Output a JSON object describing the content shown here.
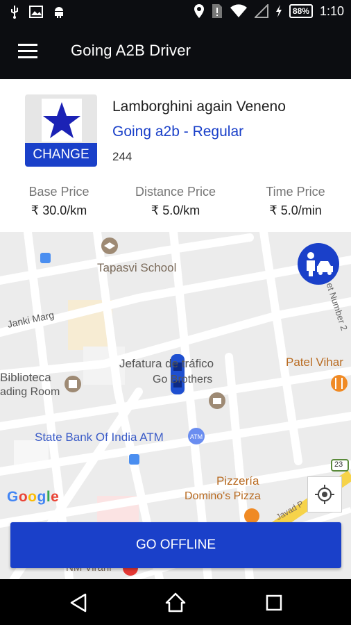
{
  "status_bar": {
    "battery": "88%",
    "time": "1:10"
  },
  "app_bar": {
    "title": "Going A2B Driver"
  },
  "vehicle": {
    "change_label": "CHANGE",
    "name": "Lamborghini again Veneno",
    "service": "Going a2b - Regular",
    "number": "244"
  },
  "prices": [
    {
      "label": "Base Price",
      "value": "₹ 30.0/km"
    },
    {
      "label": "Distance Price",
      "value": "₹ 5.0/km"
    },
    {
      "label": "Time Price",
      "value": "₹ 5.0/min"
    }
  ],
  "map": {
    "labels": {
      "tapasvi": "Tapasvi School",
      "janki": "Janki Marg",
      "jefatura": "Jefatura de tráfico",
      "brothers": "Go Brothers",
      "patel": "Patel Vihar",
      "biblioteca": "Biblioteca",
      "reading": "ading Room",
      "sbi": "State Bank Of India ATM",
      "pizzeria": "Pizzería",
      "dominos": "Domino's Pizza",
      "street": "et Number 2",
      "nm": "NM Virani",
      "road": "Javad P",
      "route": "23",
      "google": "Google"
    }
  },
  "actions": {
    "go_offline": "GO OFFLINE"
  },
  "colors": {
    "primary": "#1a40c9",
    "app_bar": "#0c0d11"
  }
}
